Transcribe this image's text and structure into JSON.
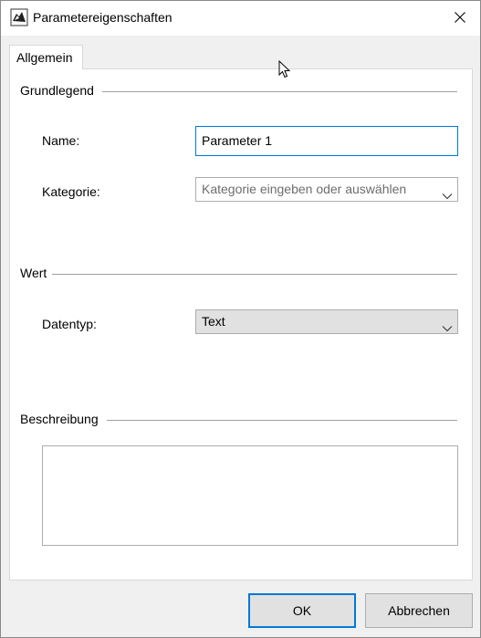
{
  "window": {
    "title": "Parametereigenschaften"
  },
  "tabs": [
    {
      "label": "Allgemein",
      "selected": true
    }
  ],
  "groups": {
    "basic": {
      "title": "Grundlegend",
      "name_label": "Name:",
      "name_value": "Parameter 1",
      "category_label": "Kategorie:",
      "category_placeholder": "Kategorie eingeben oder auswählen"
    },
    "value": {
      "title": "Wert",
      "datatype_label": "Datentyp:",
      "datatype_value": "Text"
    },
    "description": {
      "title": "Beschreibung",
      "text": ""
    }
  },
  "buttons": {
    "ok": "OK",
    "cancel": "Abbrechen"
  },
  "icons": {
    "app": "rhino-app-icon",
    "close": "close-icon",
    "dropdown": "chevron-down-icon"
  },
  "colors": {
    "accent": "#0078d7",
    "window_bg": "#f0f0f0",
    "panel_bg": "#ffffff",
    "button_bg": "#e1e1e1"
  }
}
